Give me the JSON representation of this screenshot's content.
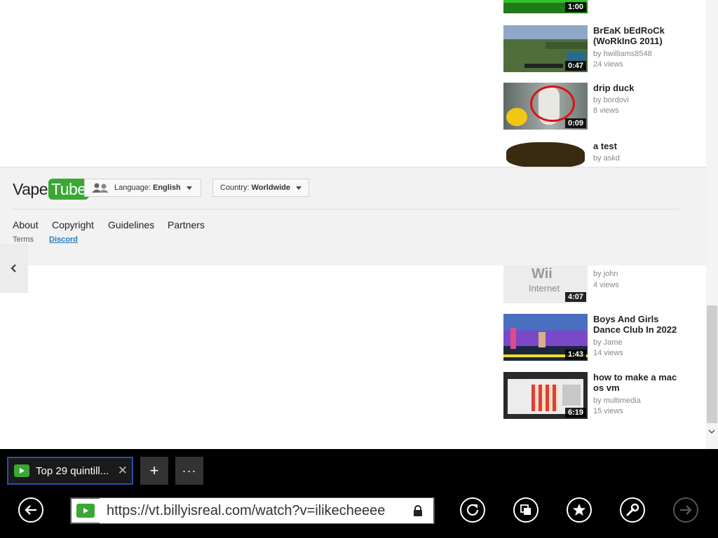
{
  "videos": [
    {
      "title": "",
      "author": "",
      "views": "",
      "duration": "1:00"
    },
    {
      "title": "BrEaK bEdRoCk (WoRkInG 2011)",
      "author": "by hwilliams8548",
      "views": "24 views",
      "duration": "0:47"
    },
    {
      "title": "drip duck",
      "author": "by bordovi",
      "views": "8 views",
      "duration": "0:09"
    },
    {
      "title": "a test",
      "author": "by askd",
      "views": "",
      "duration": ""
    },
    {
      "title": "",
      "author": "by john",
      "views": "4 views",
      "duration": "4:07",
      "thumb_text": "Wii",
      "thumb_sub": "Internet"
    },
    {
      "title": "Boys And Girls Dance Club In 2022",
      "author": "by Jame",
      "views": "14 views",
      "duration": "1:43"
    },
    {
      "title": "how to make a mac os vm",
      "author": "by multimedia",
      "views": "15 views",
      "duration": "6:19"
    }
  ],
  "footer": {
    "logo_left": "Vape",
    "logo_right": "Tube",
    "language_label": "Language:",
    "language_value": "English",
    "country_label": "Country:",
    "country_value": "Worldwide",
    "links": [
      "About",
      "Copyright",
      "Guidelines",
      "Partners"
    ],
    "small_links": [
      "Terms",
      "Discord"
    ]
  },
  "browser": {
    "tab_title": "Top 29 quintill...",
    "tab_close": "✕",
    "new_tab": "+",
    "more": "···",
    "url": "https://vt.billyisreal.com/watch?v=ilikecheeee"
  },
  "colors": {
    "brand_green": "#3aa832",
    "link_blue": "#2a7ab8",
    "tab_border": "#2d4ea8"
  },
  "icons": [
    "back-icon",
    "refresh-icon",
    "tabs-icon",
    "favorites-icon",
    "tools-icon",
    "forward-icon",
    "lock-icon",
    "person-icon",
    "chevron-left-icon"
  ]
}
